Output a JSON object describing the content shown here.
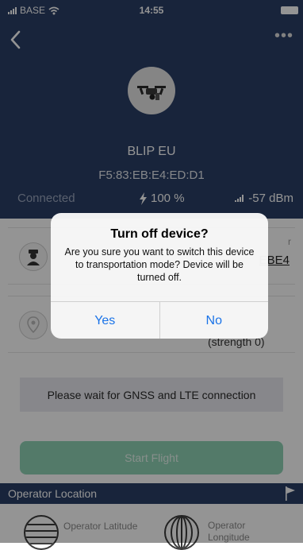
{
  "status_bar": {
    "carrier": "BASE",
    "time": "14:55"
  },
  "device": {
    "name": "BLIP EU",
    "mac": "F5:83:EB:E4:ED:D1",
    "connection": "Connected",
    "battery": "100 %",
    "signal": "-57 dBm"
  },
  "behind": {
    "serial_partial": "EBE4",
    "strength": "(strength 0)",
    "label_partial": "r"
  },
  "gnss_banner": "Please wait for GNSS and LTE connection",
  "start_flight": "Start Flight",
  "operator": {
    "section_title": "Operator Location",
    "latitude_label": "Operator Latitude",
    "longitude_label": "Operator Longitude"
  },
  "dialog": {
    "title": "Turn off device?",
    "message": "Are you sure you want to switch this device to transportation mode? Device will be turned off.",
    "yes": "Yes",
    "no": "No"
  },
  "colors": {
    "header": "#2a3f66",
    "accent": "#1a73e8",
    "start_button": "#8fd2b6"
  }
}
